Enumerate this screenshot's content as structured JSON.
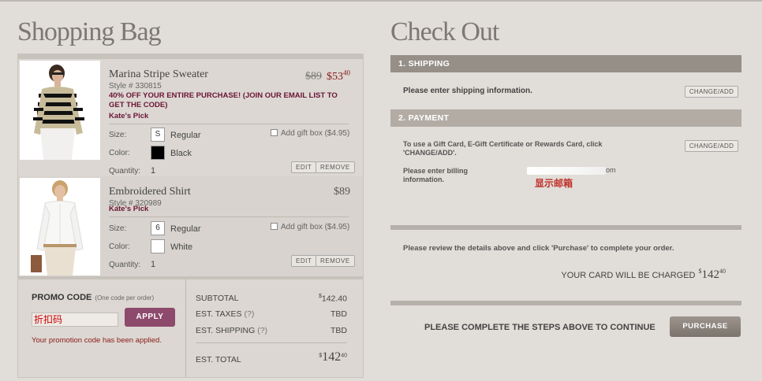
{
  "bag": {
    "title": "Shopping Bag",
    "items": [
      {
        "name": "Marina Stripe Sweater",
        "style": "Style # 330815",
        "promo": "40% OFF YOUR ENTIRE PURCHASE! (JOIN OUR EMAIL LIST TO GET THE CODE)",
        "tag": "Kate's Pick",
        "price_orig": "$89",
        "price_sale": "$53",
        "price_sale_cents": "40",
        "size_label": "Size:",
        "size": "S",
        "size_name": "Regular",
        "color_label": "Color:",
        "color": "Black",
        "qty_label": "Quantity:",
        "qty": "1",
        "giftbox": "Add gift box ($4.95)",
        "edit": "EDIT",
        "remove": "REMOVE"
      },
      {
        "name": "Embroidered Shirt",
        "style": "Style # 320989",
        "tag": "Kate's Pick",
        "price": "$89",
        "size_label": "Size:",
        "size": "6",
        "size_name": "Regular",
        "color_label": "Color:",
        "color": "White",
        "qty_label": "Quantity:",
        "qty": "1",
        "giftbox": "Add gift box ($4.95)",
        "edit": "EDIT",
        "remove": "REMOVE"
      }
    ],
    "promo": {
      "label": "PROMO CODE",
      "hint": "(One code per order)",
      "input_value": "折扣码",
      "apply": "APPLY",
      "applied_msg": "Your promotion code has been applied."
    },
    "totals": {
      "subtotal_label": "SUBTOTAL",
      "subtotal_cur": "$",
      "subtotal": "142.40",
      "taxes_label": "EST. TAXES",
      "taxes_q": "(?)",
      "taxes": "TBD",
      "shipping_label": "EST. SHIPPING",
      "shipping_q": "(?)",
      "shipping": "TBD",
      "total_label": "EST. TOTAL",
      "total_cur": "$",
      "total": "142",
      "total_cents": "40"
    }
  },
  "checkout": {
    "title": "Check Out",
    "shipping_header": "1. SHIPPING",
    "shipping_text": "Please enter shipping information.",
    "change_add": "CHANGE/ADD",
    "payment_header": "2. PAYMENT",
    "payment_text": "To use a Gift Card, E-Gift Certificate or Rewards Card, click 'CHANGE/ADD'.",
    "billing_text": "Please enter billing information.",
    "email_tail": "om",
    "email_note": "显示邮箱",
    "review_text": "Please review the details above and click 'Purchase' to complete your order.",
    "charged_label": "YOUR CARD WILL BE CHARGED",
    "charged_cur": "$",
    "charged_amount": "142",
    "charged_cents": "40",
    "steps_text": "PLEASE COMPLETE THE STEPS ABOVE TO CONTINUE",
    "purchase": "PURCHASE"
  }
}
